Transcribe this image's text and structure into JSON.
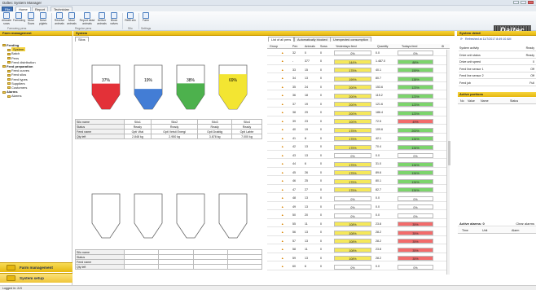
{
  "window": {
    "title": "Daltec System Manager"
  },
  "menu_tabs": [
    "File",
    "Home",
    "Report",
    "Technician"
  ],
  "ribbon": {
    "buttons": [
      {
        "label": "Allocate sows",
        "icon": "allocate-icon"
      },
      {
        "label": "Farrowing",
        "icon": "farrowing-icon"
      },
      {
        "label": "Move Sows",
        "icon": "move-sows-icon"
      },
      {
        "label": "Move piglets",
        "icon": "move-piglets-icon"
      },
      {
        "label": "Receive animals",
        "icon": "receive-icon"
      },
      {
        "label": "Move animals",
        "icon": "move-animals-icon"
      },
      {
        "label": "Report dead animals",
        "icon": "report-dead-icon"
      },
      {
        "label": "Deliver animals",
        "icon": "deliver-icon"
      },
      {
        "label": "Block valves",
        "icon": "block-valves-icon"
      },
      {
        "label": "Refill silo",
        "icon": "refill-icon"
      },
      {
        "label": "Farm",
        "icon": "farm-icon"
      }
    ],
    "groups": [
      "Farrowing pens",
      "Regular pens",
      "Silo",
      "Settings"
    ],
    "logo": "Daltec"
  },
  "left_panel": {
    "title": "Farm management",
    "tree": [
      {
        "label": "Feeding",
        "level": 0,
        "bold": true
      },
      {
        "label": "System",
        "level": 2,
        "selected": true
      },
      {
        "label": "Batch",
        "level": 2
      },
      {
        "label": "Pens",
        "level": 2
      },
      {
        "label": "Feed distribution",
        "level": 2
      },
      {
        "label": "Feed preparation",
        "level": 0,
        "bold": true
      },
      {
        "label": "Feed curves",
        "level": 2
      },
      {
        "label": "Feed silos",
        "level": 2
      },
      {
        "label": "Feed types",
        "level": 2
      },
      {
        "label": "Suppliers",
        "level": 2
      },
      {
        "label": "Customers",
        "level": 2
      },
      {
        "label": "Alarms",
        "level": 0,
        "bold": true
      },
      {
        "label": "Alarms",
        "level": 2
      }
    ],
    "nav_buttons": [
      "Farm management",
      "System setup"
    ]
  },
  "system": {
    "title": "System",
    "silo_tab": "Silos",
    "silos": [
      {
        "name": "Silo1",
        "status": "Ready",
        "feed": "Opti Vital",
        "qty": "2.848 kg",
        "percent": "37%",
        "fill": 0.37,
        "color": "#e01b22"
      },
      {
        "name": "Silo2",
        "status": "Ready",
        "feed": "Opti Vetsti Energi",
        "qty": "2.950 kg",
        "percent": "19%",
        "fill": 0.19,
        "color": "#2f6fd0"
      },
      {
        "name": "Silo3",
        "status": "Ready",
        "feed": "Opti Drøktig",
        "qty": "3.878 kg",
        "percent": "38%",
        "fill": 0.38,
        "color": "#3aa93a"
      },
      {
        "name": "Silo4",
        "status": "Ready",
        "feed": "Opti Løbte",
        "qty": "7.000 kg",
        "percent": "69%",
        "fill": 0.69,
        "color": "#f2e21c"
      }
    ],
    "row_labels": [
      "Silo name",
      "Status",
      "Feed name",
      "Qty left"
    ]
  },
  "pens": {
    "tabs": [
      "List of all pens",
      "Automatically blocked",
      "Unexpected consumption"
    ],
    "headers": [
      "Group",
      "Pen",
      "Animals",
      "Sows",
      "Yesterdays feed",
      "Quantity",
      "Todays feed"
    ],
    "rows": [
      [
        "",
        "32",
        "0",
        "0",
        "0%",
        "0.0",
        "0%"
      ],
      [
        "",
        "-",
        "377",
        "0",
        "144%",
        "1.487.0",
        "88%"
      ],
      [
        "",
        "33",
        "15",
        "0",
        "175%",
        "40.1",
        "159%"
      ],
      [
        "",
        "34",
        "13",
        "0",
        "199%",
        "80.7",
        "138%"
      ],
      [
        "",
        "35",
        "24",
        "0",
        "200%",
        "153.6",
        "123%"
      ],
      [
        "",
        "36",
        "18",
        "0",
        "200%",
        "115.2",
        "123%"
      ],
      [
        "",
        "37",
        "19",
        "0",
        "200%",
        "121.6",
        "123%"
      ],
      [
        "",
        "38",
        "29",
        "0",
        "200%",
        "186.4",
        "123%"
      ],
      [
        "",
        "39",
        "23",
        "0",
        "100%",
        "72.5",
        "49%"
      ],
      [
        "",
        "40",
        "19",
        "0",
        "175%",
        "109.6",
        "200%"
      ],
      [
        "",
        "41",
        "8",
        "0",
        "175%",
        "42.1",
        "134%"
      ],
      [
        "",
        "42",
        "13",
        "0",
        "175%",
        "70.4",
        "134%"
      ],
      [
        "",
        "43",
        "13",
        "0",
        "0%",
        "0.0",
        "0%"
      ],
      [
        "",
        "44",
        "6",
        "0",
        "175%",
        "31.0",
        "134%"
      ],
      [
        "",
        "45",
        "26",
        "0",
        "175%",
        "89.6",
        "134%"
      ],
      [
        "",
        "46",
        "25",
        "0",
        "175%",
        "80.1",
        "134%"
      ],
      [
        "",
        "47",
        "27",
        "0",
        "175%",
        "82.7",
        "134%"
      ],
      [
        "",
        "48",
        "13",
        "0",
        "0%",
        "0.0",
        "0%"
      ],
      [
        "",
        "49",
        "13",
        "0",
        "0%",
        "0.0",
        "0%"
      ],
      [
        "",
        "50",
        "20",
        "0",
        "0%",
        "0.0",
        "0%"
      ],
      [
        "",
        "55",
        "11",
        "0",
        "108%",
        "23.8",
        "35%"
      ],
      [
        "",
        "56",
        "13",
        "0",
        "108%",
        "28.2",
        "35%"
      ],
      [
        "",
        "57",
        "13",
        "0",
        "108%",
        "28.2",
        "35%"
      ],
      [
        "",
        "58",
        "11",
        "0",
        "108%",
        "23.8",
        "35%"
      ],
      [
        "",
        "59",
        "13",
        "0",
        "108%",
        "28.2",
        "35%"
      ],
      [
        "",
        "60",
        "6",
        "0",
        "0%",
        "0.0",
        "0%"
      ]
    ]
  },
  "right_panel": {
    "title": "System detail",
    "refreshed": "Refreshed at 11/7/2017 8:49:10 AM",
    "details": [
      {
        "k": "System activity",
        "v": "Ready"
      },
      {
        "k": "Drive unit status",
        "v": "Ready"
      },
      {
        "k": "Drive unit speed",
        "v": "0"
      },
      {
        "k": "Feed line sensor 1",
        "v": "Off"
      },
      {
        "k": "Feed line sensor 2",
        "v": "Off"
      },
      {
        "k": "Feed job",
        "v": "Full"
      }
    ],
    "active_portions": "Active portions",
    "portion_headers": [
      "No",
      "Value",
      "Name",
      "Status"
    ],
    "active_alarms": "Active alarms: 0",
    "clear_alarms": "Clear alarms",
    "alarm_headers": [
      "Time",
      "Unit",
      "Alarm"
    ]
  },
  "statusbar": {
    "text": "Logged in: JLS"
  }
}
